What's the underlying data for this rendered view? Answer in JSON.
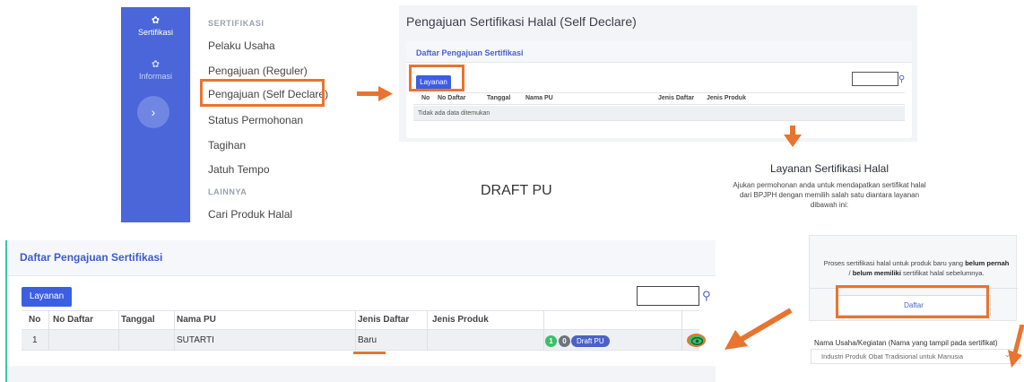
{
  "sidebar": {
    "rail": [
      {
        "label": "Sertifikasi",
        "icon": "gear-icon"
      },
      {
        "label": "Informasi",
        "icon": "gear-icon"
      }
    ],
    "expand_icon": "chevron-right-icon",
    "sections": [
      {
        "heading": "SERTIFIKASI",
        "items": [
          "Pelaku Usaha",
          "Pengajuan (Reguler)",
          "Pengajuan (Self Declare)",
          "Status Permohonan",
          "Tagihan",
          "Jatuh Tempo"
        ]
      },
      {
        "heading": "LAINNYA",
        "items": [
          "Cari Produk Halal"
        ]
      }
    ]
  },
  "top_page": {
    "title": "Pengajuan Sertifikasi Halal (Self Declare)",
    "card_title": "Daftar Pengajuan Sertifikasi",
    "layanan_button": "Layanan",
    "columns": [
      "No",
      "No Daftar",
      "Tanggal",
      "Nama PU",
      "Jenis Daftar",
      "Jenis Produk"
    ],
    "empty_text": "Tidak ada data ditemukan"
  },
  "draft_label": "DRAFT PU",
  "layanan_info": {
    "title": "Layanan Sertifikasi Halal",
    "description": "Ajukan permohonan anda untuk mendapatkan sertifikat halal dari BPJPH dengan memilih salah satu diantara layanan dibawah ini:"
  },
  "bottom_page": {
    "card_title": "Daftar Pengajuan Sertifikasi",
    "layanan_button": "Layanan",
    "columns": [
      "No",
      "No Daftar",
      "Tanggal",
      "Nama PU",
      "Jenis Daftar",
      "Jenis Produk"
    ],
    "row": {
      "no": "1",
      "no_daftar": "",
      "tanggal": "",
      "nama_pu": "SUTARTI",
      "jenis_daftar": "Baru",
      "jenis_produk": "",
      "badge1": "1",
      "badge2": "0",
      "status": "Draft PU"
    }
  },
  "self_declare_option": {
    "desc_pre": "Proses sertifikasi halal untuk produk baru yang",
    "desc_bold1": "belum pernah",
    "desc_mid": "/",
    "desc_bold2": "belum memiliki",
    "desc_post": "sertifikat halal sebelumnya.",
    "button": "Daftar"
  },
  "usaha_field": {
    "label": "Nama Usaha/Kegiatan (Nama yang tampil pada sertifikat)",
    "value": "Industri Produk Obat Tradisional untuk Manusia"
  },
  "colors": {
    "accent": "#e8742f",
    "primary": "#3c5ee0",
    "sidebar": "#4a66d8",
    "success": "#3bbf6a",
    "teal": "#39c7a6"
  }
}
